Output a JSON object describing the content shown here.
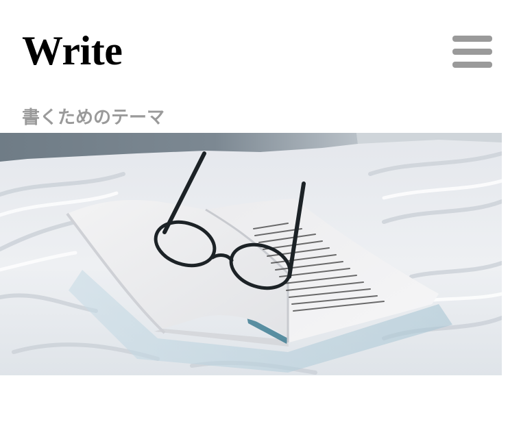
{
  "header": {
    "site_title": "Write",
    "tagline": "書くためのテーマ",
    "menu_icon": "hamburger-menu-icon"
  },
  "hero": {
    "image_subject": "open-book-with-glasses-on-bed-photo"
  },
  "colors": {
    "title": "#000000",
    "tagline": "#9a9a9a",
    "menu_icon": "#9a9a9a",
    "background": "#ffffff"
  }
}
